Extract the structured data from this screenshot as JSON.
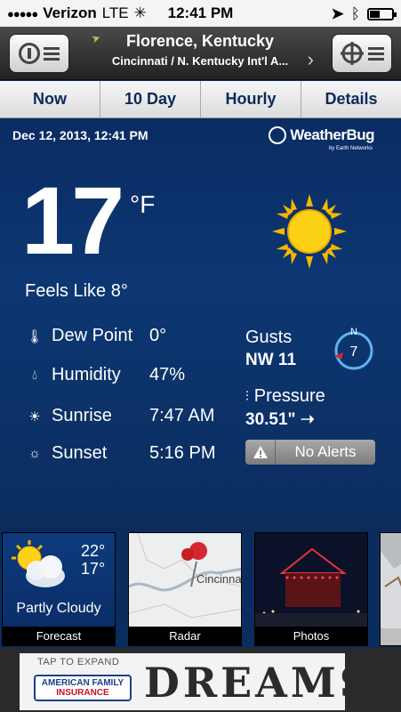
{
  "status_bar": {
    "signal": "●●●●●",
    "carrier": "Verizon",
    "network": "LTE",
    "time": "12:41 PM"
  },
  "header": {
    "city": "Florence, Kentucky",
    "station": "Cincinnati / N. Kentucky Int'l A..."
  },
  "tabs": [
    {
      "label": "Now"
    },
    {
      "label": "10 Day"
    },
    {
      "label": "Hourly"
    },
    {
      "label": "Details"
    }
  ],
  "main": {
    "datetime": "Dec 12, 2013, 12:41 PM",
    "logo": "WeatherBug",
    "logo_sub": "by Earth Networks",
    "temp": "17",
    "unit": "°F",
    "feels_like": "Feels Like 8°",
    "dew_point": {
      "label": "Dew Point",
      "value": "0°"
    },
    "humidity": {
      "label": "Humidity",
      "value": "47%"
    },
    "sunrise": {
      "label": "Sunrise",
      "value": "7:47 AM"
    },
    "sunset": {
      "label": "Sunset",
      "value": "5:16 PM"
    },
    "gusts_label": "Gusts",
    "gusts_value": "NW 11",
    "wind_speed": "7",
    "wind_compass_letter": "N",
    "pressure_label": "Pressure",
    "pressure_value": "30.51\" ➝",
    "alerts": "No Alerts"
  },
  "thumbnails": {
    "forecast": {
      "hi": "22°",
      "lo": "17°",
      "condition": "Partly Cloudy",
      "caption": "Forecast"
    },
    "radar": {
      "caption": "Radar",
      "map_label": "Cincinna"
    },
    "photos": {
      "caption": "Photos"
    }
  },
  "ad": {
    "tap": "TAP TO EXPAND",
    "brand_line1": "AMERICAN FAMILY",
    "brand_line2": "INSURANCE",
    "word": "DREAMS"
  },
  "colors": {
    "panel": "#0d3773",
    "tab_text": "#0b2a5a",
    "alert_bg": "#8c8c8c"
  }
}
